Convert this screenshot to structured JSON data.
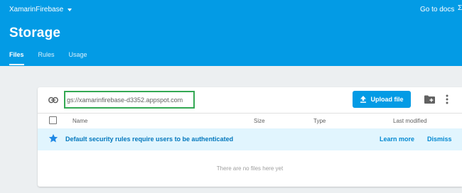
{
  "header": {
    "project_name": "XamarinFirebase",
    "docs_link": "Go to docs",
    "edge_glyph": "Ʃ",
    "page_title": "Storage",
    "tabs": [
      {
        "label": "Files",
        "active": true
      },
      {
        "label": "Rules",
        "active": false
      },
      {
        "label": "Usage",
        "active": false
      }
    ]
  },
  "toolbar": {
    "bucket_url": "gs://xamarinfirebase-d3352.appspot.com",
    "upload_label": "Upload file"
  },
  "table": {
    "columns": [
      "Name",
      "Size",
      "Type",
      "Last modified"
    ]
  },
  "banner": {
    "message": "Default security rules require users to be authenticated",
    "learn_more": "Learn more",
    "dismiss": "Dismiss"
  },
  "empty_message": "There are no files here yet",
  "colors": {
    "header_bg": "#039be5",
    "banner_bg": "#e1f5fe",
    "highlight_border": "#34a853"
  }
}
